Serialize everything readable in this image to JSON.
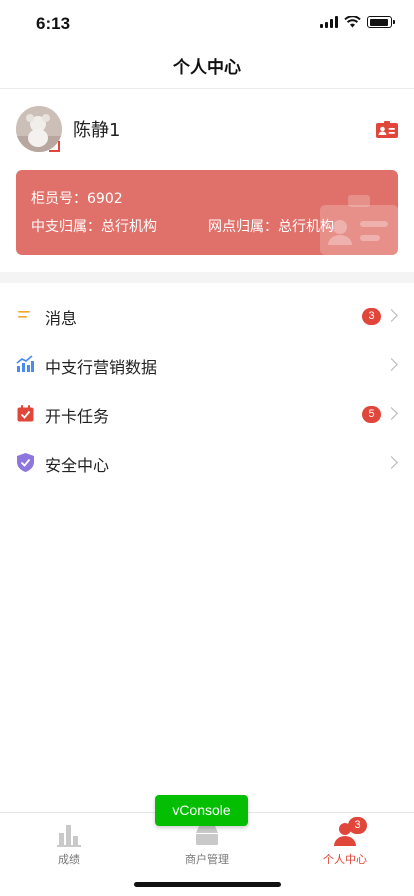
{
  "status_bar": {
    "time": "6:13",
    "battery_level": 0.9
  },
  "nav": {
    "title": "个人中心"
  },
  "profile": {
    "name": "陈静1",
    "teller_id_text": "柜员号：6902",
    "branch_text": "中支归属：总行机构",
    "outlet_text": "网点归属：总行机构"
  },
  "menu": {
    "items": [
      {
        "label": "消息",
        "badge": "3",
        "icon": "message-icon"
      },
      {
        "label": "中支行营销数据",
        "badge": "",
        "icon": "stats-icon"
      },
      {
        "label": "开卡任务",
        "badge": "5",
        "icon": "calendar-check-icon"
      },
      {
        "label": "安全中心",
        "badge": "",
        "icon": "shield-check-icon"
      }
    ]
  },
  "vconsole": {
    "label": "vConsole"
  },
  "tabs": [
    {
      "label": "成绩",
      "icon": "bar-chart-icon"
    },
    {
      "label": "商户管理",
      "icon": "store-icon"
    },
    {
      "label": "个人中心",
      "icon": "person-icon",
      "badge": "3",
      "active": true
    }
  ],
  "colors": {
    "accent": "#e0463a",
    "card": "#e0716a",
    "vconsole": "#04be02"
  }
}
